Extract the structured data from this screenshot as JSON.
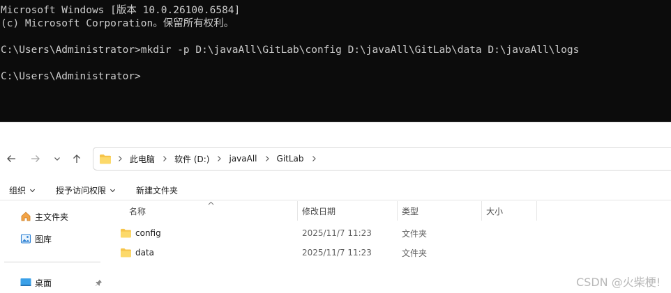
{
  "terminal": {
    "lines": [
      "Microsoft Windows [版本 10.0.26100.6584]",
      "(c) Microsoft Corporation。保留所有权利。",
      "",
      "C:\\Users\\Administrator>mkdir -p D:\\javaAll\\GitLab\\config D:\\javaAll\\GitLab\\data D:\\javaAll\\logs",
      "",
      "C:\\Users\\Administrator>"
    ]
  },
  "explorer": {
    "breadcrumb": [
      "此电脑",
      "软件 (D:)",
      "javaAll",
      "GitLab"
    ],
    "commands": {
      "organize": "组织",
      "access": "授予访问权限",
      "new_folder": "新建文件夹"
    },
    "sidebar": {
      "items": [
        "主文件夹",
        "图库",
        "桌面"
      ]
    },
    "columns": {
      "name": "名称",
      "modified": "修改日期",
      "type": "类型",
      "size": "大小"
    },
    "files": [
      {
        "name": "config",
        "modified": "2025/11/7 11:23",
        "type": "文件夹"
      },
      {
        "name": "data",
        "modified": "2025/11/7 11:23",
        "type": "文件夹"
      }
    ],
    "colors": {
      "folder": "#f6c44a",
      "terminal_bg": "#0c0c0c",
      "terminal_fg": "#cccccc"
    }
  },
  "watermark": "CSDN @火柴梗!"
}
